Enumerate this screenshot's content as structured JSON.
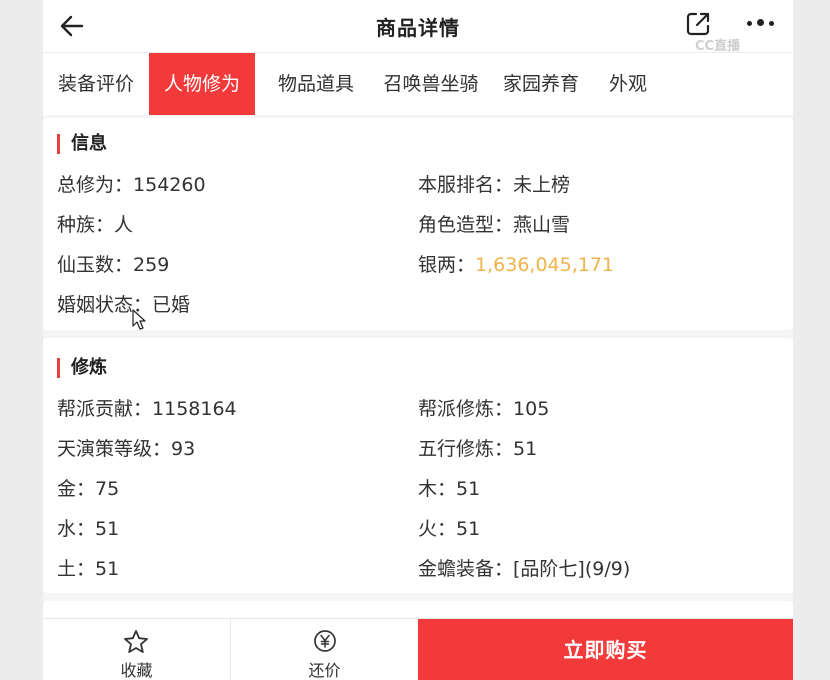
{
  "header": {
    "title": "商品详情",
    "watermark": "CC直播"
  },
  "tabs": [
    {
      "label": "装备评价",
      "active": false
    },
    {
      "label": "人物修为",
      "active": true
    },
    {
      "label": "物品道具",
      "active": false
    },
    {
      "label": "召唤兽坐骑",
      "active": false
    },
    {
      "label": "家园养育",
      "active": false
    },
    {
      "label": "外观",
      "active": false
    }
  ],
  "info": {
    "title": "信息",
    "items": [
      {
        "key": "总修为：",
        "value": "154260"
      },
      {
        "key": "本服排名：",
        "value": "未上榜"
      },
      {
        "key": "种族：",
        "value": "人"
      },
      {
        "key": "角色造型：",
        "value": "燕山雪"
      },
      {
        "key": "仙玉数：",
        "value": "259"
      },
      {
        "key": "银两：",
        "value": "1,636,045,171"
      },
      {
        "key": "婚姻状态：",
        "value": "已婚"
      }
    ]
  },
  "cultivation": {
    "title": "修炼",
    "items": [
      {
        "key": "帮派贡献：",
        "value": "1158164"
      },
      {
        "key": "帮派修炼：",
        "value": "105"
      },
      {
        "key": "天演策等级：",
        "value": "93"
      },
      {
        "key": "五行修炼：",
        "value": "51"
      },
      {
        "key": "金：",
        "value": "75"
      },
      {
        "key": "木：",
        "value": "51"
      },
      {
        "key": "水：",
        "value": "51"
      },
      {
        "key": "火：",
        "value": "51"
      },
      {
        "key": "土：",
        "value": "51"
      },
      {
        "key": "金蟾装备：",
        "value": "[品阶七](9/9)"
      }
    ]
  },
  "bottom": {
    "favorite": "收藏",
    "bargain": "还价",
    "buy": "立即购买"
  },
  "colors": {
    "accent": "#f23a3a",
    "silver_value": "#f0b34a"
  }
}
